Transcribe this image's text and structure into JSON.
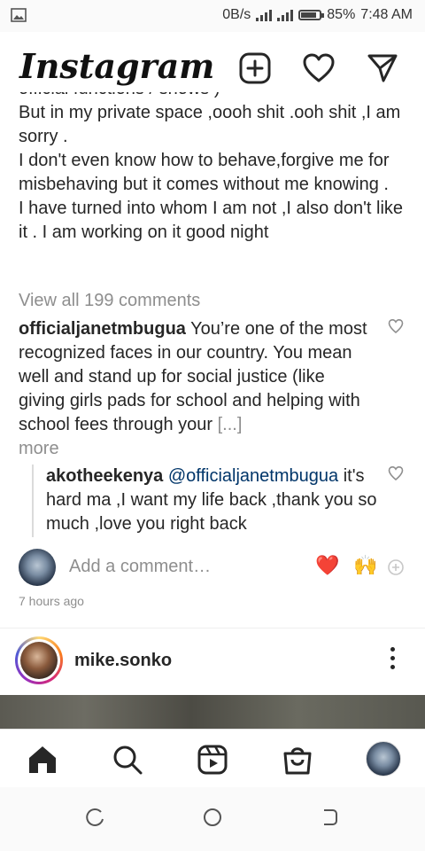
{
  "status_bar": {
    "left_icon": "image-icon",
    "speed": "0B/s",
    "battery_percent": 85,
    "battery_label": "85%",
    "time": "7:48 AM"
  },
  "app_bar": {
    "logo": "Instagram",
    "icons": [
      "new-post-icon",
      "heart-icon",
      "direct-message-icon"
    ]
  },
  "post": {
    "caption_lines": [
      "official functions / shows )",
      "But in my private space ,oooh shit .ooh shit ,I am sorry .",
      "I don't even know how to behave,forgive me for misbehaving but it comes without me knowing .",
      "I have turned into whom I am not ,I also don't like it . I am working on it good night"
    ],
    "view_all_comments": "View all 199 comments",
    "comments": [
      {
        "username": "officialjanetmbugua",
        "text": "You’re one of the most recognized faces in our country. You mean well and stand up for social justice (like giving girls pads for school and helping with school fees through your",
        "truncation": "[...]",
        "more": "more"
      }
    ],
    "replies": [
      {
        "username": "akotheekenya",
        "mention": "@officialjanetmbugua",
        "text": "it's hard ma ,I want my life back ,thank you so much ,love you right back"
      }
    ],
    "add_comment_placeholder": "Add a comment…",
    "quick_reactions": [
      "❤️",
      "🙌"
    ],
    "timestamp": "7 hours ago"
  },
  "next_post": {
    "username": "mike.sonko"
  },
  "bottom_nav": {
    "items": [
      "home-icon",
      "search-icon",
      "reels-icon",
      "shop-icon",
      "profile-avatar"
    ]
  },
  "android_nav": {
    "items": [
      "recents-icon",
      "home-button-icon",
      "back-icon"
    ]
  }
}
